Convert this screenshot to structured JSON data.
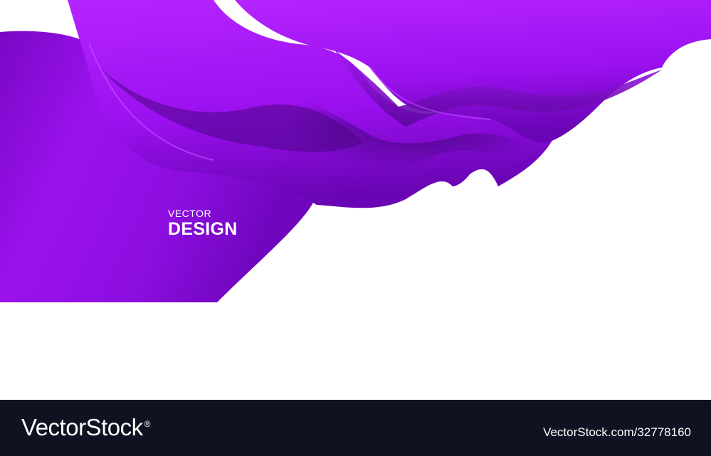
{
  "artwork": {
    "label_small": "VECTOR",
    "label_big": "DESIGN",
    "colors": {
      "fabric_light": "#b21cff",
      "fabric_mid": "#8a0bd8",
      "fabric_dark": "#4d0589",
      "background": "#ffffff"
    }
  },
  "footer": {
    "brand": "VectorStock",
    "brand_mark": "®",
    "image_id": "VectorStock.com/32778160",
    "background": "#0f1220"
  }
}
